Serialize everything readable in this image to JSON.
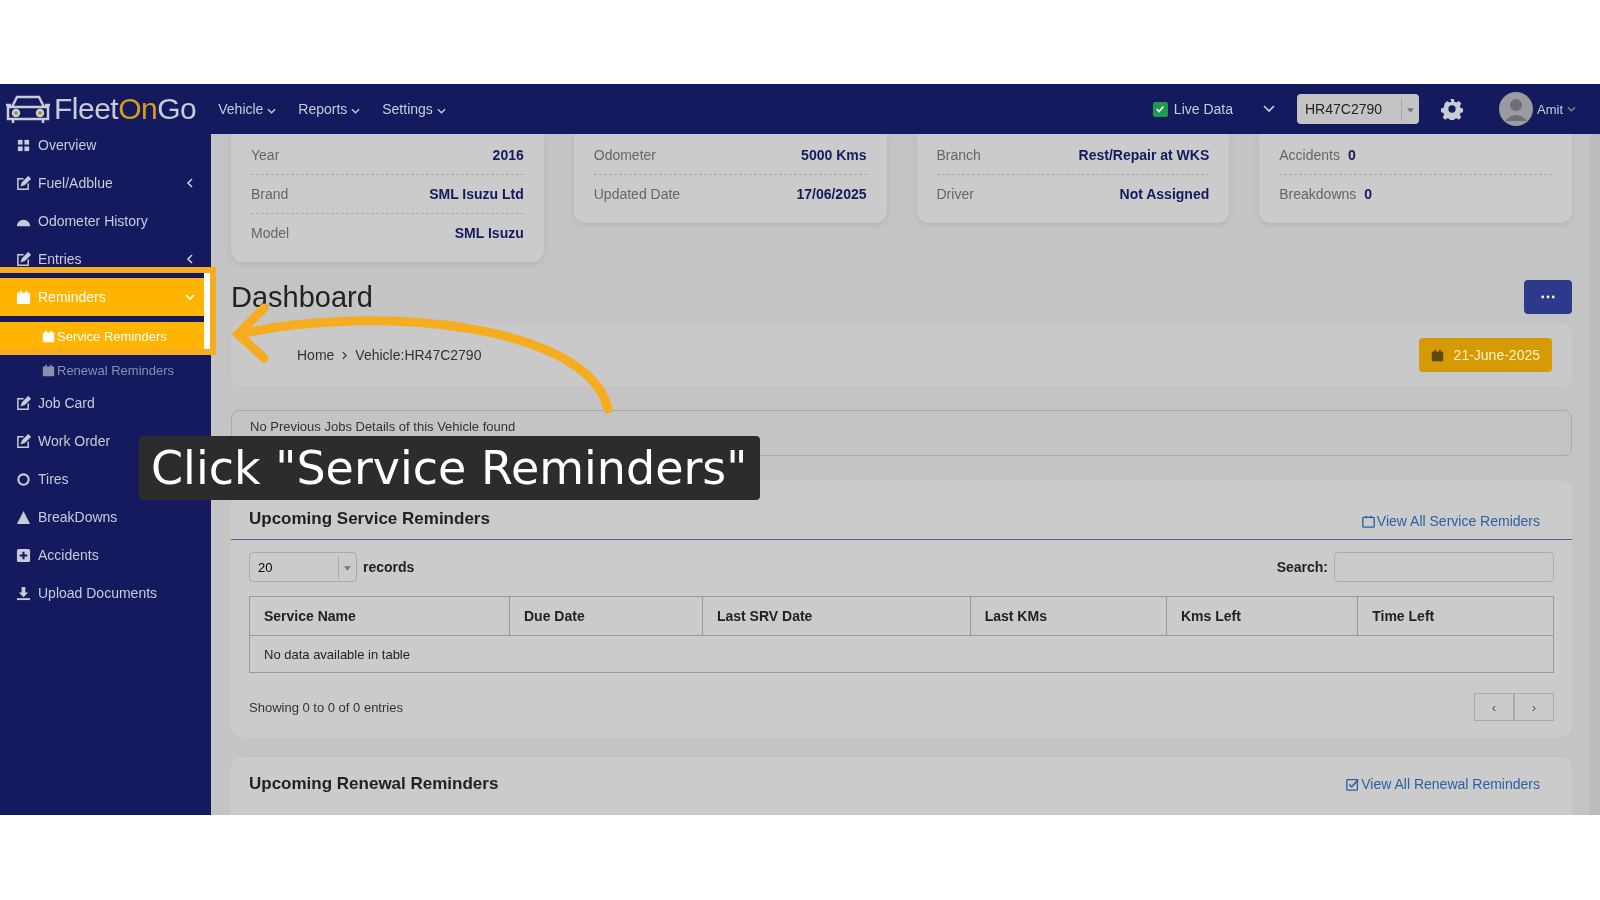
{
  "navbar": {
    "logo": {
      "part_1": "Fleet",
      "part_2": "On",
      "part_3": "Go"
    },
    "menus": [
      {
        "label": "Vehicle"
      },
      {
        "label": "Reports"
      },
      {
        "label": "Settings"
      }
    ],
    "live_data": {
      "label": "Live Data",
      "checked": true
    },
    "vehicle_select": {
      "value": "HR47C2790"
    },
    "user": {
      "name": "Amit"
    }
  },
  "sidebar": {
    "items": [
      {
        "label": "Overview",
        "kind": "link",
        "selected": false
      },
      {
        "label": "Fuel/Adblue",
        "kind": "group",
        "expanded": false,
        "selected": false
      },
      {
        "label": "Odometer History",
        "kind": "link",
        "selected": false
      },
      {
        "label": "Entries",
        "kind": "group",
        "expanded": false,
        "selected": false
      },
      {
        "label": "Reminders",
        "kind": "group",
        "expanded": true,
        "selected": true,
        "children": [
          {
            "label": "Service Reminders",
            "selected": true
          },
          {
            "label": "Renewal Reminders",
            "selected": false
          }
        ]
      },
      {
        "label": "Job Card",
        "kind": "link",
        "selected": false
      },
      {
        "label": "Work Order",
        "kind": "link",
        "selected": false
      },
      {
        "label": "Tires",
        "kind": "link",
        "selected": false
      },
      {
        "label": "BreakDowns",
        "kind": "link",
        "selected": false
      },
      {
        "label": "Accidents",
        "kind": "link",
        "selected": false
      },
      {
        "label": "Upload Documents",
        "kind": "link",
        "selected": false
      }
    ]
  },
  "info_cards": [
    {
      "kind": "split",
      "rows": [
        {
          "label": "Year",
          "value": "2016"
        },
        {
          "label": "Brand",
          "value": "SML Isuzu Ltd"
        },
        {
          "label": "Model",
          "value": "SML Isuzu"
        }
      ]
    },
    {
      "kind": "split",
      "rows": [
        {
          "label": "Odometer",
          "value": "5000 Kms"
        },
        {
          "label": "Updated Date",
          "value": "17/06/2025"
        }
      ]
    },
    {
      "kind": "split",
      "rows": [
        {
          "label": "Branch",
          "value": "Rest/Repair at WKS"
        },
        {
          "label": "Driver",
          "value": "Not Assigned"
        }
      ]
    },
    {
      "kind": "inline",
      "rows": [
        {
          "label": "Accidents",
          "value": "0"
        },
        {
          "label": "Breakdowns",
          "value": "0"
        }
      ]
    }
  ],
  "page_title": "Dashboard",
  "breadcrumb": [
    {
      "label": "Home"
    },
    {
      "label": "Vehicle:HR47C2790"
    }
  ],
  "date_button": "21-June-2025",
  "notice": "No Previous Jobs Details of this Vehicle found",
  "service_panel": {
    "title": "Upcoming Service Reminders",
    "link": "View All Service Remiders",
    "page_size": "20",
    "records_label": "records",
    "search_label": "Search:",
    "table": {
      "columns": [
        "Service Name",
        "Due Date",
        "Last SRV Date",
        "Last KMs",
        "Kms Left",
        "Time Left"
      ],
      "empty_text": "No data available in table"
    },
    "info": "Showing 0 to 0 of 0 entries",
    "prev": "‹",
    "next": "›"
  },
  "renewal_panel": {
    "title": "Upcoming Renewal Reminders",
    "link": "View All Renewal Reminders"
  },
  "callout": {
    "text": "Click \"Service Reminders\""
  }
}
